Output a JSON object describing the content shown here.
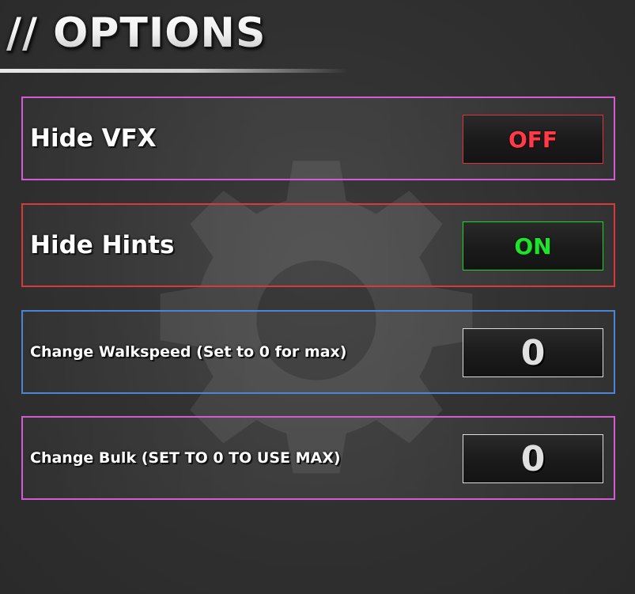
{
  "header": {
    "title": "// OPTIONS"
  },
  "colors": {
    "off": "#ff3b4a",
    "on": "#1fe32c",
    "border_pink": "#d55ad5",
    "border_red": "#d83a3a",
    "border_blue": "#4a86d8"
  },
  "options": [
    {
      "label": "Hide VFX",
      "type": "toggle",
      "value": "OFF"
    },
    {
      "label": "Hide Hints",
      "type": "toggle",
      "value": "ON"
    },
    {
      "label": "Change Walkspeed (Set to 0 for max)",
      "type": "number",
      "value": "0"
    },
    {
      "label": "Change Bulk (SET TO 0 TO USE MAX)",
      "type": "number",
      "value": "0"
    }
  ],
  "background_icon": "gear-icon"
}
